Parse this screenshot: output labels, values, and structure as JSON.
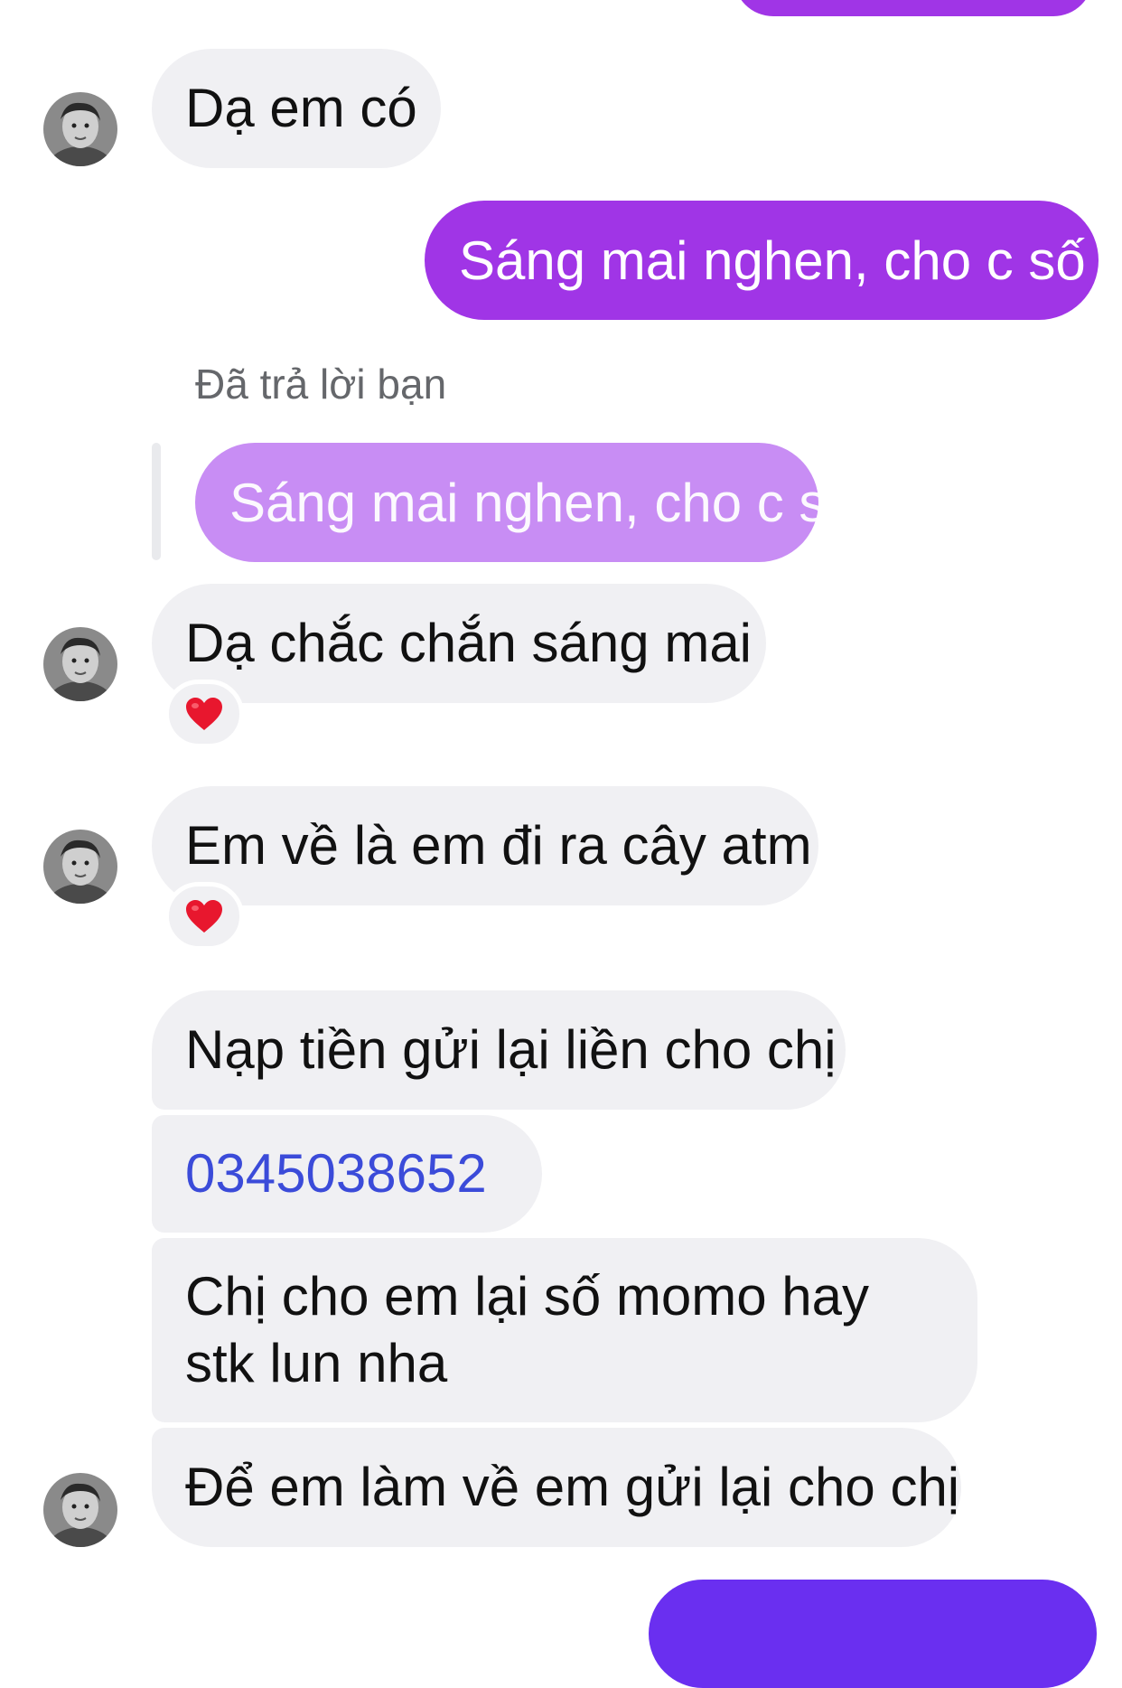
{
  "conversation": {
    "reply_label": "Đã trả lời bạn",
    "messages": [
      {
        "from": "self",
        "text": ""
      },
      {
        "from": "contact",
        "text": "Dạ em có"
      },
      {
        "from": "self",
        "text": "Sáng mai nghen, cho c số"
      },
      {
        "from": "contact",
        "quoted": "Sáng mai nghen, cho c số"
      },
      {
        "from": "contact",
        "text": "Dạ chắc chắn sáng mai",
        "reaction": "❤️"
      },
      {
        "from": "contact",
        "text": "Em về là em đi ra cây atm",
        "reaction": "❤️"
      },
      {
        "from": "contact",
        "text": "Nạp tiền gửi lại liền cho chị"
      },
      {
        "from": "contact",
        "text": "0345038652",
        "is_link": true
      },
      {
        "from": "contact",
        "text": "Chị cho em lại số momo hay stk lun nha"
      },
      {
        "from": "contact",
        "text": "Để em làm về em gửi lại cho chị"
      },
      {
        "from": "self",
        "text": ""
      }
    ]
  },
  "colors": {
    "sent_bubble": "#a035e6",
    "sent_bubble_bottom": "#6a2ff0",
    "quoted_bubble": "#c88df4",
    "received_bubble": "#f0f0f3",
    "link": "#3b4bd9",
    "reaction_heart": "#e8172e"
  },
  "icons": {
    "avatar": "contact-avatar",
    "reaction": "heart-icon"
  }
}
